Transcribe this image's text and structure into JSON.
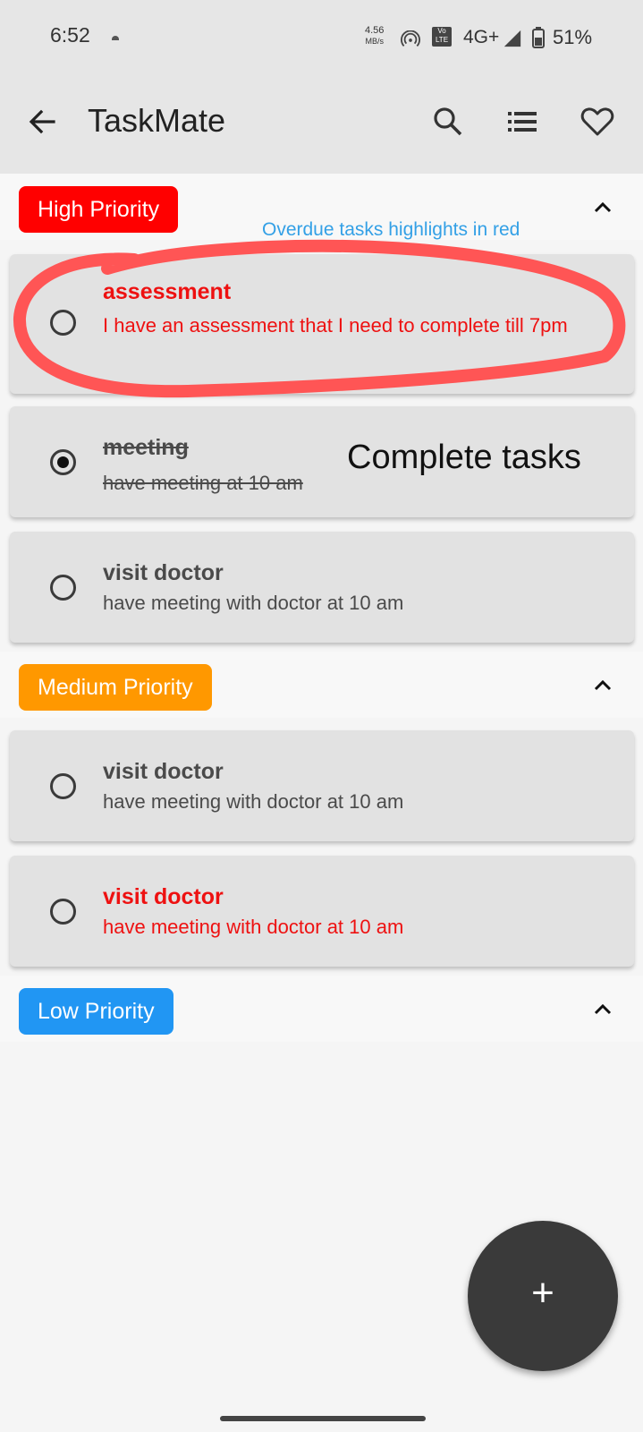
{
  "status_bar": {
    "time": "6:52",
    "speed_value": "4.56",
    "speed_unit": "MB/s",
    "volte_label": "Vo LTE",
    "network": "4G+",
    "battery": "51%"
  },
  "app_bar": {
    "title": "TaskMate",
    "icons": [
      "back-arrow-icon",
      "search-icon",
      "list-icon",
      "heart-icon"
    ]
  },
  "annotations": {
    "overdue_note": "Overdue tasks highlights in red",
    "complete_note": "Complete tasks",
    "highlight_color": "#ff5555"
  },
  "sections": {
    "high": {
      "label": "High Priority",
      "color": "#ff0000",
      "tasks": [
        {
          "title": "assessment",
          "description": "I have an assessment that I need to complete till 7pm",
          "completed": false,
          "overdue": true
        },
        {
          "title": "meeting",
          "description": "have meeting at 10 am",
          "completed": true,
          "overdue": false
        },
        {
          "title": "visit doctor",
          "description": "have meeting with doctor at 10 am",
          "completed": false,
          "overdue": false
        }
      ]
    },
    "medium": {
      "label": "Medium Priority",
      "color": "#ff9800",
      "tasks": [
        {
          "title": "visit doctor",
          "description": "have meeting with doctor at 10 am",
          "completed": false,
          "overdue": false
        },
        {
          "title": "visit doctor",
          "description": "have meeting with doctor at 10 am",
          "completed": false,
          "overdue": true
        }
      ]
    },
    "low": {
      "label": "Low Priority",
      "color": "#2196f3",
      "tasks": []
    }
  },
  "fab": {
    "label": "+",
    "icon": "plus-icon"
  },
  "colors": {
    "overdue_text": "#ee1111",
    "annotation_blue": "#33a0e6",
    "fab": "#3a3a3a"
  }
}
